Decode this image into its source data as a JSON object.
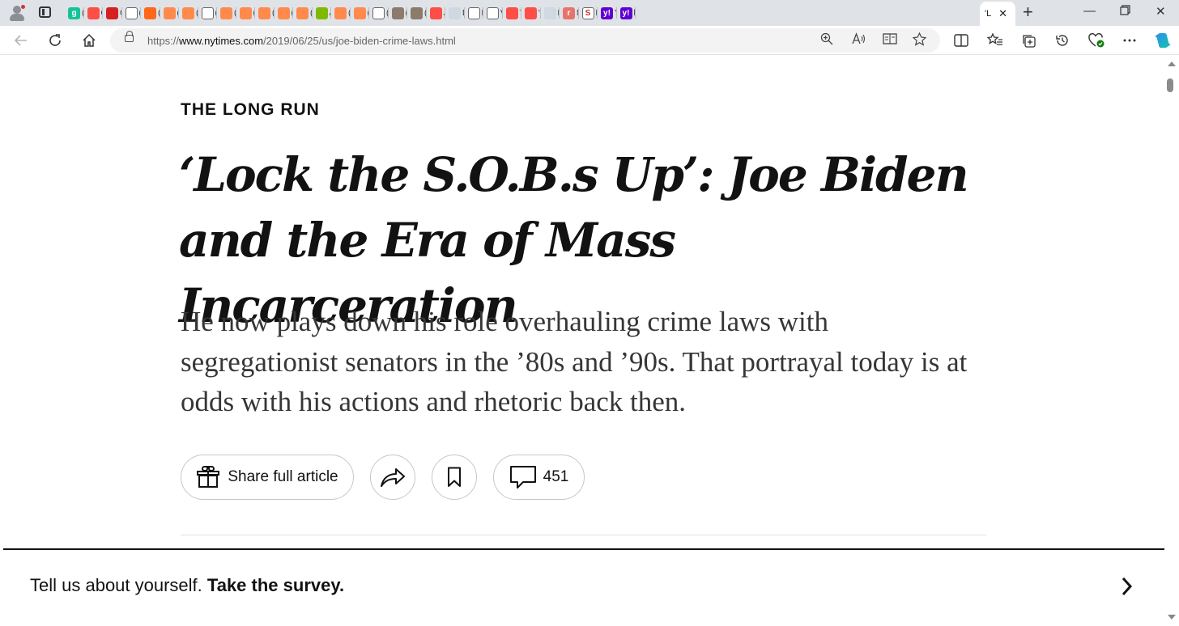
{
  "browser": {
    "tabs": [
      {
        "icon": "grammarly-icon",
        "color": "#15c39a",
        "glyph": "g",
        "label": "(4"
      },
      {
        "icon": "youtube-icon",
        "color": "#ff4e45",
        "glyph": "",
        "label": "C"
      },
      {
        "icon": "pdf-icon",
        "color": "#d61f1f",
        "glyph": "",
        "label": "G"
      },
      {
        "icon": "document-icon",
        "color": "#ffffff",
        "glyph": "",
        "label": "("
      },
      {
        "icon": "substack-icon",
        "color": "#ff6719",
        "glyph": "",
        "label": "("
      },
      {
        "icon": "substack-icon",
        "color": "#ff8a4c",
        "glyph": "",
        "label": "("
      },
      {
        "icon": "substack-icon",
        "color": "#ff8a4c",
        "glyph": "",
        "label": "("
      },
      {
        "icon": "document-icon",
        "color": "#ffffff",
        "glyph": "",
        "label": "("
      },
      {
        "icon": "substack-icon",
        "color": "#ff8a4c",
        "glyph": "",
        "label": "("
      },
      {
        "icon": "substack-icon",
        "color": "#ff8a4c",
        "glyph": "",
        "label": "("
      },
      {
        "icon": "substack-icon",
        "color": "#ff8a4c",
        "glyph": "",
        "label": "("
      },
      {
        "icon": "substack-icon",
        "color": "#ff8a4c",
        "glyph": "",
        "label": "("
      },
      {
        "icon": "substack-icon",
        "color": "#ff8a4c",
        "glyph": "",
        "label": "("
      },
      {
        "icon": "microsoft-icon",
        "color": "#7fba00",
        "glyph": "",
        "label": "A"
      },
      {
        "icon": "substack-icon",
        "color": "#ff8a4c",
        "glyph": "",
        "label": "("
      },
      {
        "icon": "substack-icon",
        "color": "#ff8a4c",
        "glyph": "",
        "label": "("
      },
      {
        "icon": "document-icon",
        "color": "#ffffff",
        "glyph": "",
        "label": "("
      },
      {
        "icon": "image-thumbnail-icon",
        "color": "#8c7b6b",
        "glyph": "",
        "label": "("
      },
      {
        "icon": "image-thumbnail-icon",
        "color": "#8c7b6b",
        "glyph": "",
        "label": "("
      },
      {
        "icon": "youtube-icon",
        "color": "#ff4e45",
        "glyph": "",
        "label": "Ju"
      },
      {
        "icon": "wikipedia-icon",
        "color": "#cfd8e3",
        "glyph": "",
        "label": "D"
      },
      {
        "icon": "document-icon",
        "color": "#ffffff",
        "glyph": "",
        "label": "F("
      },
      {
        "icon": "document-icon",
        "color": "#ffffff",
        "glyph": "",
        "label": "V"
      },
      {
        "icon": "youtube-icon",
        "color": "#ff4e45",
        "glyph": "",
        "label": "Tr"
      },
      {
        "icon": "youtube-icon",
        "color": "#ff4e45",
        "glyph": "",
        "label": "\"I"
      },
      {
        "icon": "wikipedia-icon",
        "color": "#cfd8e3",
        "glyph": "",
        "label": "B"
      },
      {
        "icon": "red-square-icon",
        "color": "#e8736a",
        "glyph": "r",
        "label": "N"
      },
      {
        "icon": "slate-icon",
        "color": "#ffffff",
        "glyph": "S",
        "label": "R"
      },
      {
        "icon": "yahoo-icon",
        "color": "#6001d2",
        "glyph": "y!",
        "label": "Y"
      },
      {
        "icon": "yahoo-icon",
        "color": "#6001d2",
        "glyph": "y!",
        "label": "b"
      }
    ],
    "active_tab_label": "'L",
    "url_prefix": "https://",
    "url_host": "www.nytimes.com",
    "url_path": "/2019/06/25/us/joe-biden-crime-laws.html",
    "accent": "#0f6cbd"
  },
  "article": {
    "kicker": "THE LONG RUN",
    "headline": "‘Lock the S.O.B.s Up’: Joe Biden and the Era of Mass Incarceration",
    "summary": "He now plays down his role overhauling crime laws with segregationist senators in the ’80s and ’90s. That portrayal today is at odds with his actions and rhetoric back then.",
    "share_label": "Share full article",
    "comment_count": "451"
  },
  "survey": {
    "prompt": "Tell us about yourself.",
    "cta": "Take the survey."
  }
}
